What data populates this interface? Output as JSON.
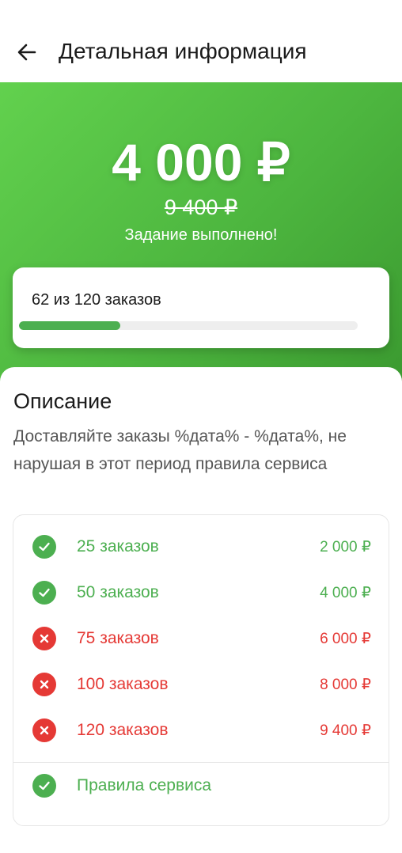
{
  "header": {
    "back_icon": "arrow-left-icon",
    "title": "Детальная информация"
  },
  "hero": {
    "amount": "4 000 ₽",
    "old_amount": "9 400 ₽",
    "status": "Задание выполнено!"
  },
  "progress": {
    "text": "62 из 120 заказов",
    "done": 62,
    "total": 120,
    "fraction": 0.3
  },
  "description": {
    "title": "Описание",
    "text": "Доставляйте заказы %дата% - %дата%, не нарушая в этот период правила сервиса"
  },
  "milestones": [
    {
      "label": "25 заказов",
      "value": "2 000 ₽",
      "status": "done",
      "icon": "check-circle-icon"
    },
    {
      "label": "50 заказов",
      "value": "4 000 ₽",
      "status": "done",
      "icon": "check-circle-icon"
    },
    {
      "label": "75 заказов",
      "value": "6 000 ₽",
      "status": "fail",
      "icon": "cross-circle-icon"
    },
    {
      "label": "100 заказов",
      "value": "8 000 ₽",
      "status": "fail",
      "icon": "cross-circle-icon"
    },
    {
      "label": "120 заказов",
      "value": "9 400 ₽",
      "status": "fail",
      "icon": "cross-circle-icon"
    }
  ],
  "rules": {
    "label": "Правила сервиса",
    "icon": "check-circle-icon"
  },
  "colors": {
    "success": "#4caf50",
    "error": "#e53935",
    "hero_gradient_start": "#62d14e",
    "hero_gradient_end": "#3b9a30"
  }
}
